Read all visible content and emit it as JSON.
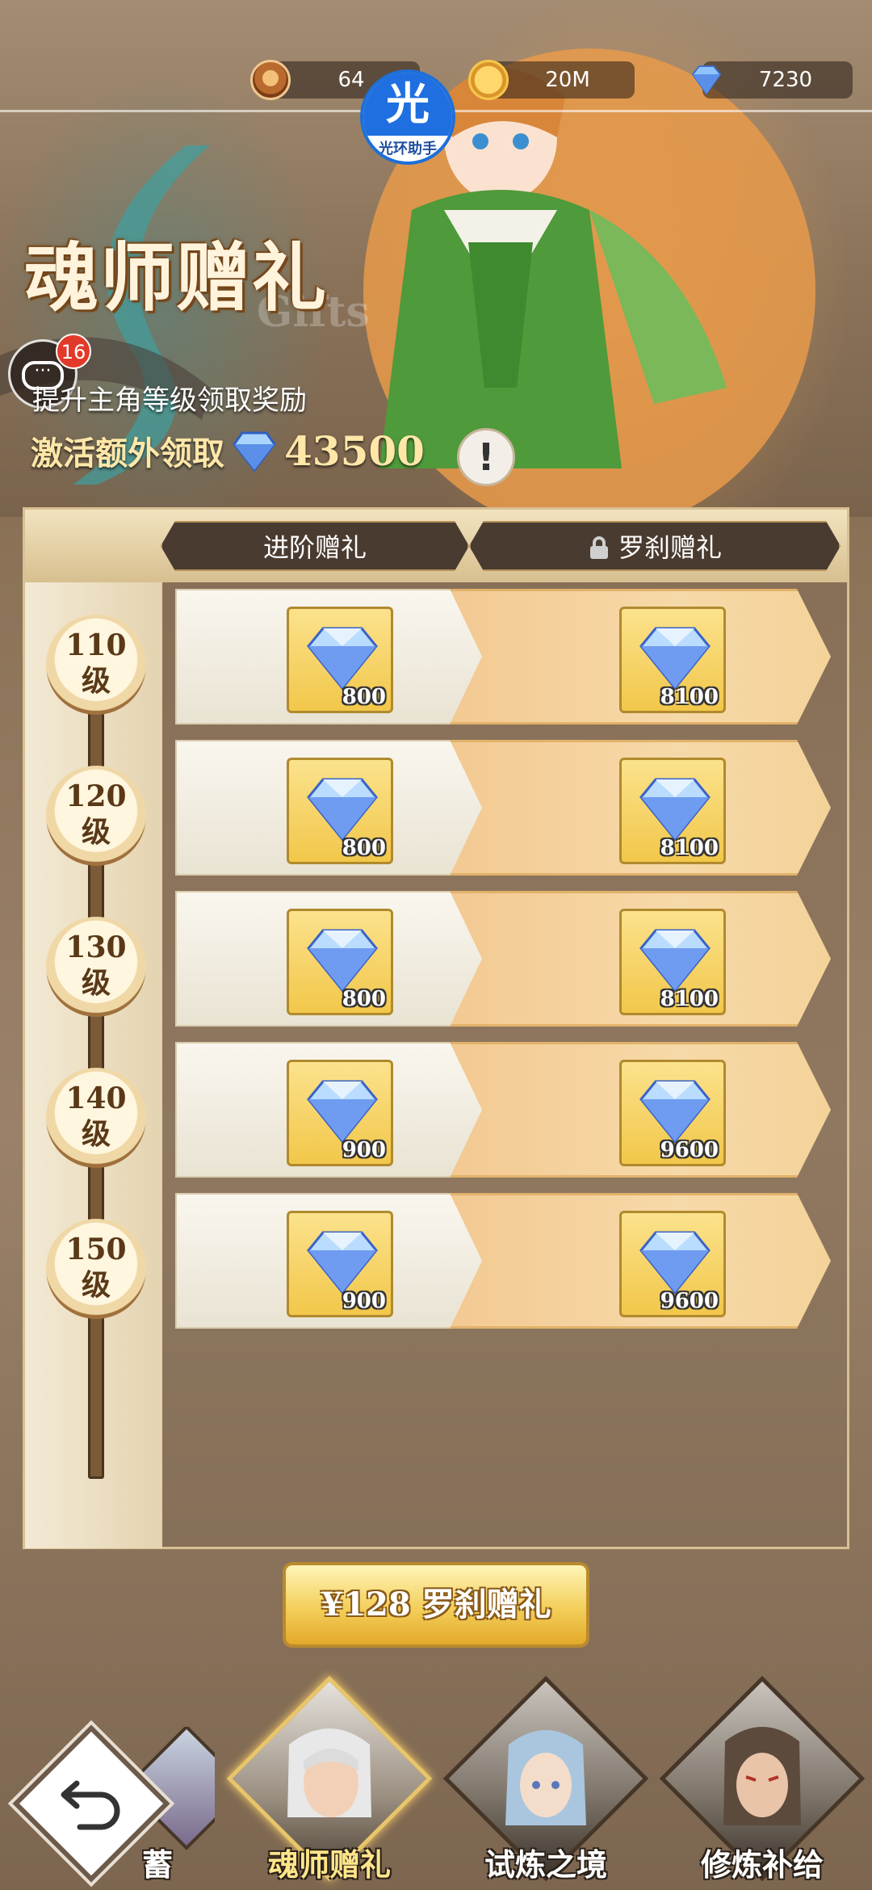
{
  "resources": {
    "level": "64",
    "gold": "20M",
    "diamonds": "7230"
  },
  "assistant_badge": {
    "glyph": "光",
    "label": "光环助手"
  },
  "event": {
    "title": "魂师赠礼",
    "title_en": "Gifts",
    "subtitle": "提升主角等级领取奖励",
    "activate_label": "激活额外领取",
    "activate_amount": "43500",
    "info_label": "!"
  },
  "chat": {
    "unread": "16"
  },
  "tabs": [
    {
      "label": "进阶赠礼",
      "locked": false
    },
    {
      "label": "罗刹赠礼",
      "locked": true
    }
  ],
  "rewards": [
    {
      "level": "110",
      "unit": "级",
      "free": "800",
      "premium": "8100"
    },
    {
      "level": "120",
      "unit": "级",
      "free": "800",
      "premium": "8100"
    },
    {
      "level": "130",
      "unit": "级",
      "free": "800",
      "premium": "8100"
    },
    {
      "level": "140",
      "unit": "级",
      "free": "900",
      "premium": "9600"
    },
    {
      "level": "150",
      "unit": "级",
      "free": "900",
      "premium": "9600"
    }
  ],
  "purchase": {
    "label": "¥128 罗刹赠礼"
  },
  "bottom_nav": {
    "partial_label": "蓄",
    "items": [
      {
        "label": "魂师赠礼",
        "active": true
      },
      {
        "label": "试炼之境",
        "active": false
      },
      {
        "label": "修炼补给",
        "active": false
      }
    ]
  },
  "colors": {
    "accent_gold": "#f3cf5a",
    "panel_border": "#d8c094",
    "gem_blue": "#5b8fe8"
  }
}
